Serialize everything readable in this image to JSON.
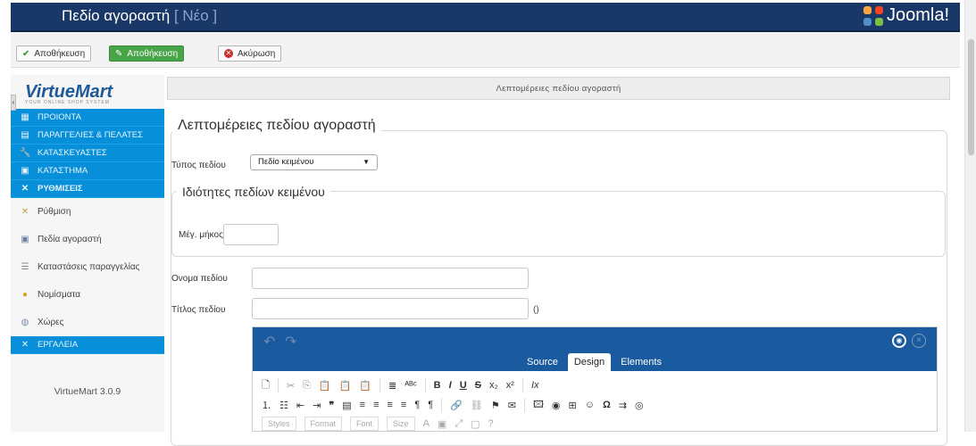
{
  "header": {
    "title": "Πεδίο αγοραστή",
    "title_suffix": "[ Νέο ]",
    "brand": "Joomla!"
  },
  "toolbar": {
    "save_label": "Αποθήκευση",
    "save_close_label": "Αποθήκευση",
    "cancel_label": "Ακύρωση"
  },
  "sidebar": {
    "logo_text": "VirtueMart",
    "logo_tagline": "YOUR ONLINE SHOP SYSTEM",
    "items": [
      {
        "label": "ΠΡΟΙΟΝΤΑ",
        "icon": "box-icon"
      },
      {
        "label": "ΠΑΡΑΓΓΕΛΙΕΣ & ΠΕΛΑΤΕΣ",
        "icon": "orders-icon"
      },
      {
        "label": "ΚΑΤΑΣΚΕΥΑΣΤΕΣ",
        "icon": "wrench-icon"
      },
      {
        "label": "ΚΑΤΑΣΤΗΜΑ",
        "icon": "shop-icon"
      },
      {
        "label": "ΡΥΘΜΙΣΕΙΣ",
        "icon": "settings-icon"
      }
    ],
    "subitems": [
      {
        "label": "Ρύθμιση",
        "icon": "tools-icon"
      },
      {
        "label": "Πεδία αγοραστή",
        "icon": "form-icon"
      },
      {
        "label": "Καταστάσεις παραγγελίας",
        "icon": "list-icon"
      },
      {
        "label": "Νομίσματα",
        "icon": "coins-icon"
      },
      {
        "label": "Χώρες",
        "icon": "globe-icon"
      }
    ],
    "tools_label": "ΕΡΓΑΛΕΙΑ",
    "version": "VirtueMart 3.0.9"
  },
  "main": {
    "panel_title": "Λεπτομέρειες πεδίου αγοραστή",
    "fieldset_title": "Λεπτομέρειες πεδίου αγοραστή",
    "field_type_label": "Τύπος πεδίου",
    "field_type_value": "Πεδίο κειμένου",
    "text_props_title": "Ιδιότητες πεδίων κειμένου",
    "max_length_label": "Μέγ. μήκος",
    "max_length_value": "",
    "field_name_label": "Ονομα πεδίου",
    "field_name_value": "",
    "field_title_label": "Τίτλος πεδίου",
    "field_title_value": "",
    "field_title_hint": "()"
  },
  "editor": {
    "tabs": [
      "Source",
      "Design",
      "Elements"
    ],
    "active_tab": "Design",
    "dropdowns": [
      "Styles",
      "Format",
      "Font",
      "Size"
    ]
  }
}
